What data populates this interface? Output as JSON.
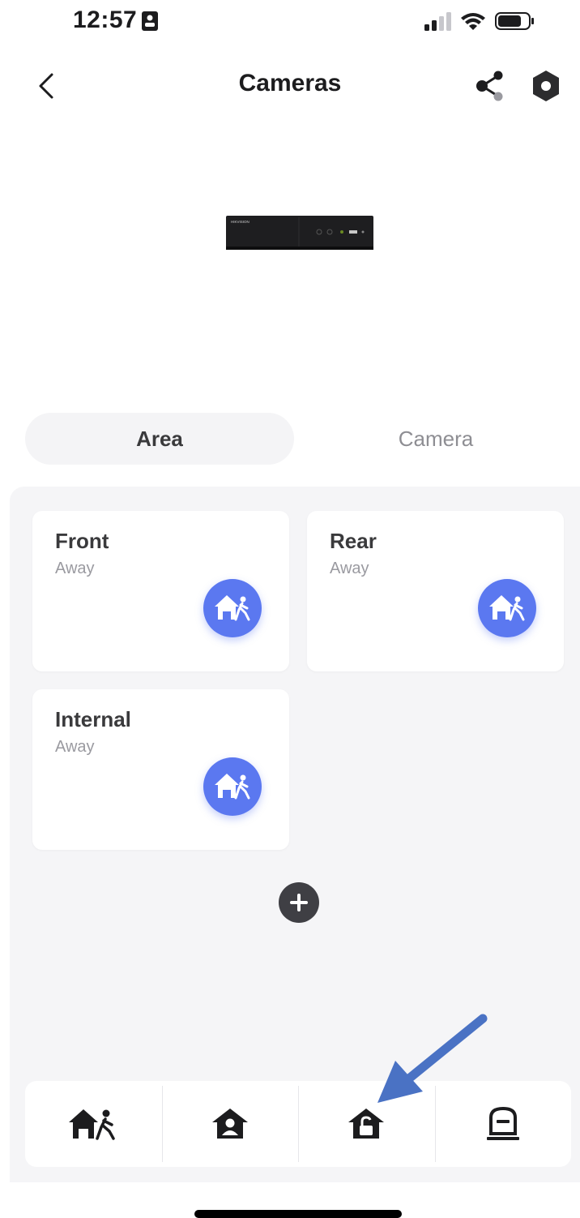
{
  "status_bar": {
    "time": "12:57"
  },
  "nav": {
    "title": "Cameras",
    "icons": [
      "back-chevron-icon",
      "share-icon",
      "settings-hex-icon"
    ]
  },
  "device": {
    "brand_text": "HIKVISION"
  },
  "tabs": [
    {
      "label": "Area",
      "selected": true
    },
    {
      "label": "Camera",
      "selected": false
    }
  ],
  "areas": [
    {
      "name": "Front",
      "status": "Away",
      "icon": "away-arm-icon"
    },
    {
      "name": "Rear",
      "status": "Away",
      "icon": "away-arm-icon"
    },
    {
      "name": "Internal",
      "status": "Away",
      "icon": "away-arm-icon"
    }
  ],
  "bottom_bar": {
    "items": [
      {
        "icon": "away-arm-icon"
      },
      {
        "icon": "stay-arm-icon"
      },
      {
        "icon": "disarm-icon"
      },
      {
        "icon": "clear-alarm-icon"
      }
    ]
  },
  "colors": {
    "accent": "#5b78f0",
    "annotation_arrow": "#4a72c4",
    "panel_bg": "#f5f5f7"
  }
}
